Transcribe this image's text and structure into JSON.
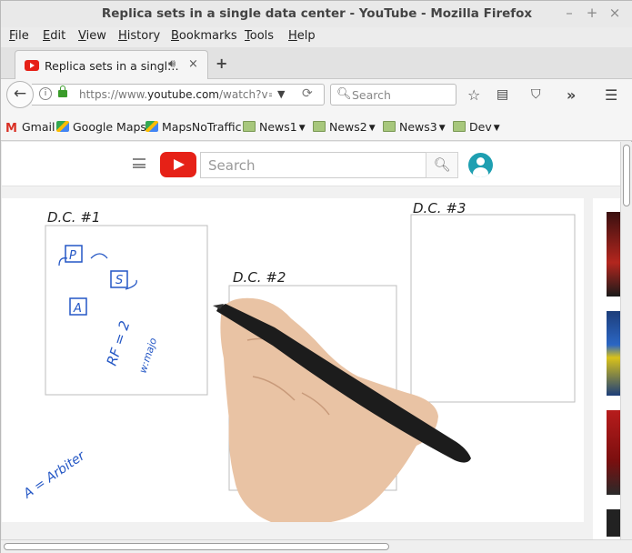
{
  "window": {
    "title": "Replica sets in a single data center - YouTube - Mozilla Firefox",
    "controls": [
      "–",
      "+",
      "×"
    ]
  },
  "menu": [
    "File",
    "Edit",
    "View",
    "History",
    "Bookmarks",
    "Tools",
    "Help"
  ],
  "tab": {
    "label": "Replica sets in a singl…",
    "close": "×",
    "new_tab": "+"
  },
  "nav": {
    "back": "←",
    "url_prefix": "https://www.",
    "url_domain": "youtube.com",
    "url_suffix": "/watch?v=lSN",
    "search_placeholder": "Search"
  },
  "bookmarks": [
    {
      "label": "Gmail",
      "icon": "gmail-icon"
    },
    {
      "label": "Google Maps",
      "icon": "maps-icon"
    },
    {
      "label": "MapsNoTraffic",
      "icon": "maps-icon"
    },
    {
      "label": "News1",
      "icon": "folder-icon"
    },
    {
      "label": "News2",
      "icon": "folder-icon"
    },
    {
      "label": "News3",
      "icon": "folder-icon"
    },
    {
      "label": "Dev",
      "icon": "folder-icon"
    }
  ],
  "youtube": {
    "search_placeholder": "Search",
    "brand_color": "#e62117",
    "avatar_color": "#1e9fb1"
  },
  "video": {
    "dc1_label": "D.C. #1",
    "dc2_label": "D.C. #2",
    "dc3_label": "D.C. #3",
    "node_p": "P",
    "node_s": "S",
    "node_a": "A",
    "rf_note": "RF = 2",
    "rf_sub": "w:majo",
    "legend_note": "A = Arbiter"
  }
}
